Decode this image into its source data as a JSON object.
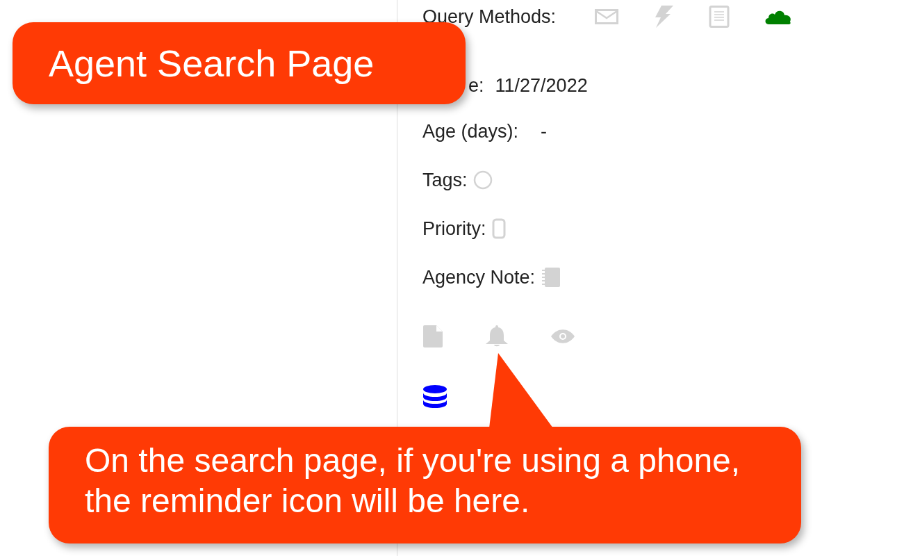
{
  "query_methods": {
    "label": "Query Methods:",
    "methods": [
      {
        "kind": "email",
        "active": false
      },
      {
        "kind": "bolt",
        "active": false
      },
      {
        "kind": "document",
        "active": false
      },
      {
        "kind": "cloud",
        "active": true
      }
    ]
  },
  "fields": [
    {
      "kind": "text",
      "label": "e:",
      "value": "11/27/2022"
    },
    {
      "kind": "text",
      "label": "Age (days):",
      "value": "-"
    },
    {
      "kind": "circle",
      "label": "Tags:"
    },
    {
      "kind": "phone",
      "label": "Priority:"
    },
    {
      "kind": "notebook",
      "label": "Agency Note:"
    }
  ],
  "actions": [
    {
      "kind": "file"
    },
    {
      "kind": "bell"
    },
    {
      "kind": "eye"
    }
  ],
  "database": {
    "active": true
  },
  "callouts": [
    {
      "kind": "title",
      "text": "Agent Search Page"
    },
    {
      "kind": "pointer",
      "text": "On the search page, if you're using a phone, the reminder icon will be here."
    }
  ]
}
